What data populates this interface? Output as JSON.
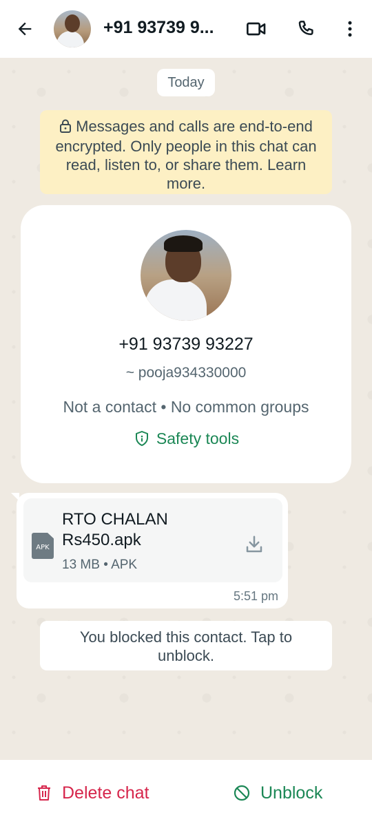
{
  "header": {
    "title": "+91 93739 9...",
    "icons": [
      "back-arrow-icon",
      "video-call-icon",
      "phone-icon",
      "more-vert-icon"
    ]
  },
  "chat": {
    "date_chip": "Today",
    "encryption_notice": "Messages and calls are end-to-end encrypted. Only people in this chat can read, listen to, or share them. Learn more.",
    "profile_card": {
      "number": "+91 93739 93227",
      "username": "~ pooja934330000",
      "info": "Not a contact • No common groups",
      "safety_tools_label": "Safety tools"
    },
    "message": {
      "file_name": "RTO CHALAN Rs450.apk",
      "file_icon_label": "APK",
      "file_meta": "13 MB • APK",
      "time": "5:51 pm"
    },
    "blocked_notice": "You blocked this contact. Tap to unblock."
  },
  "bottom_bar": {
    "delete_label": "Delete chat",
    "unblock_label": "Unblock"
  },
  "colors": {
    "accent_green": "#1b8755",
    "danger_red": "#d6254b",
    "notice_yellow": "#fdf0c4",
    "chat_bg": "#efeae2"
  }
}
